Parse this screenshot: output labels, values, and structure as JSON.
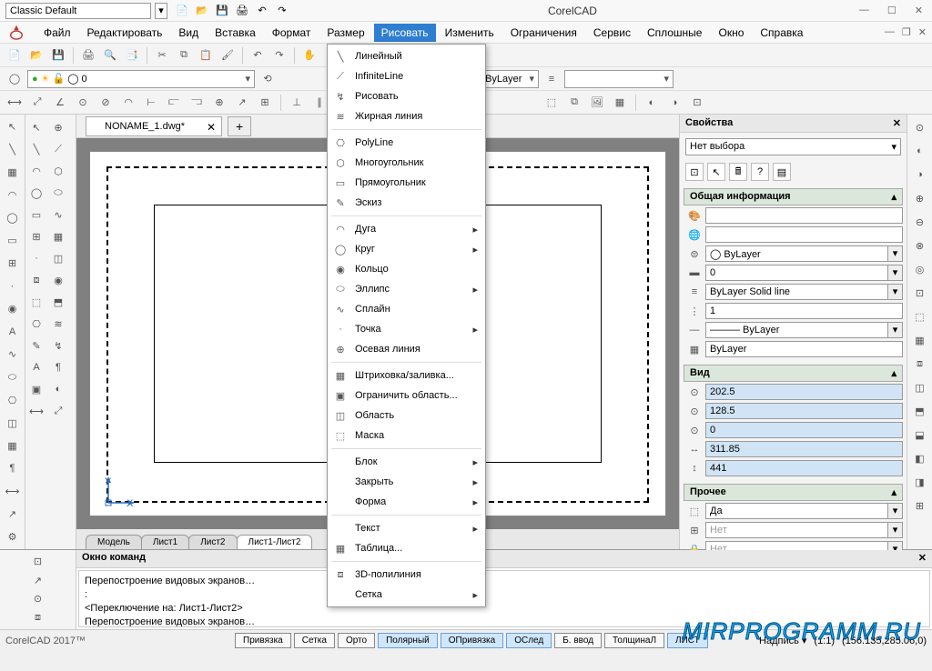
{
  "titlebar": {
    "workspace": "Classic Default",
    "app_title": "CorelCAD"
  },
  "menu": {
    "items": [
      "Файл",
      "Редактировать",
      "Вид",
      "Вставка",
      "Формат",
      "Размер",
      "Рисовать",
      "Изменить",
      "Ограничения",
      "Сервис",
      "Сплошные",
      "Окно",
      "Справка"
    ],
    "active_index": 6
  },
  "draw_menu": {
    "items": [
      {
        "label": "Линейный",
        "icon": "╲"
      },
      {
        "label": "InfiniteLine",
        "icon": "⟋"
      },
      {
        "label": "Рисовать",
        "icon": "↯"
      },
      {
        "label": "Жирная линия",
        "icon": "≋"
      },
      {
        "sep": true
      },
      {
        "label": "PolyLine",
        "icon": "⎔"
      },
      {
        "label": "Многоугольник",
        "icon": "⬡"
      },
      {
        "label": "Прямоугольник",
        "icon": "▭"
      },
      {
        "label": "Эскиз",
        "icon": "✎"
      },
      {
        "sep": true
      },
      {
        "label": "Дуга",
        "sub": true,
        "icon": "◠"
      },
      {
        "label": "Круг",
        "sub": true,
        "icon": "◯"
      },
      {
        "label": "Кольцо",
        "icon": "◉"
      },
      {
        "label": "Эллипс",
        "sub": true,
        "icon": "⬭"
      },
      {
        "label": "Сплайн",
        "icon": "∿"
      },
      {
        "label": "Точка",
        "sub": true,
        "icon": "·"
      },
      {
        "label": "Осевая линия",
        "icon": "⊕"
      },
      {
        "sep": true
      },
      {
        "label": "Штриховка/заливка...",
        "icon": "▦"
      },
      {
        "label": "Ограничить область...",
        "icon": "▣"
      },
      {
        "label": "Область",
        "icon": "◫"
      },
      {
        "label": "Маска",
        "icon": "⬚"
      },
      {
        "sep": true
      },
      {
        "label": "Блок",
        "sub": true
      },
      {
        "label": "Закрыть",
        "sub": true
      },
      {
        "label": "Форма",
        "sub": true
      },
      {
        "sep": true
      },
      {
        "label": "Текст",
        "sub": true
      },
      {
        "label": "Таблица...",
        "icon": "▦"
      },
      {
        "sep": true
      },
      {
        "label": "3D-полилиния",
        "icon": "⧈"
      },
      {
        "label": "Сетка",
        "sub": true
      }
    ]
  },
  "layer": {
    "current": "0",
    "bylayer": "ByLayer"
  },
  "document": {
    "tab_name": "NONAME_1.dwg*",
    "sheets": [
      "Модель",
      "Лист1",
      "Лист2",
      "Лист1-Лист2"
    ],
    "active_sheet": 3
  },
  "properties": {
    "panel_title": "Свойства",
    "selection": "Нет выбора",
    "sections": {
      "general": {
        "title": "Общая информация",
        "rows": [
          {
            "icon": "🎨",
            "value": ""
          },
          {
            "icon": "🌐",
            "value": ""
          },
          {
            "icon": "⊜",
            "value": "◯ ByLayer",
            "dd": true
          },
          {
            "icon": "▬",
            "value": "0",
            "dd": true
          },
          {
            "icon": "≡",
            "value": "ByLayer    Solid line",
            "dd": true
          },
          {
            "icon": "⋮",
            "value": "1"
          },
          {
            "icon": "—",
            "value": "——— ByLayer",
            "dd": true
          },
          {
            "icon": "▦",
            "value": "ByLayer"
          }
        ]
      },
      "view": {
        "title": "Вид",
        "rows": [
          {
            "icon": "⊙",
            "value": "202.5",
            "blue": true
          },
          {
            "icon": "⊙",
            "value": "128.5",
            "blue": true
          },
          {
            "icon": "⊙",
            "value": "0",
            "blue": true
          },
          {
            "icon": "↔",
            "value": "311.85",
            "blue": true
          },
          {
            "icon": "↕",
            "value": "441",
            "blue": true
          }
        ]
      },
      "other": {
        "title": "Прочее",
        "rows": [
          {
            "icon": "⬚",
            "value": "Да",
            "dd": true
          },
          {
            "icon": "⊞",
            "value": "Нет",
            "dd": true,
            "gray": true
          },
          {
            "icon": "🔒",
            "value": "Нет",
            "dd": true,
            "gray": true
          }
        ]
      }
    }
  },
  "command": {
    "title": "Окно команд",
    "lines": [
      "Перепостроение видовых экранов…",
      ":",
      "<Переключение на: Лист1-Лист2>",
      "Перепостроение видовых экранов…"
    ]
  },
  "status": {
    "app": "CorelCAD 2017™",
    "buttons": [
      {
        "label": "Привязка",
        "active": false
      },
      {
        "label": "Сетка",
        "active": false
      },
      {
        "label": "Орто",
        "active": false
      },
      {
        "label": "Полярный",
        "active": true
      },
      {
        "label": "ОПривязка",
        "active": true
      },
      {
        "label": "ОСлед",
        "active": true
      },
      {
        "label": "Б. ввод",
        "active": false
      },
      {
        "label": "ТолщинаЛ",
        "active": false
      },
      {
        "label": "ЛИСТ",
        "active": true
      }
    ],
    "annotation": "Надпись",
    "scale": "(1:1)",
    "coords": "(156.135,285.06,0)"
  },
  "watermark": "MIRPROGRAMM.RU"
}
